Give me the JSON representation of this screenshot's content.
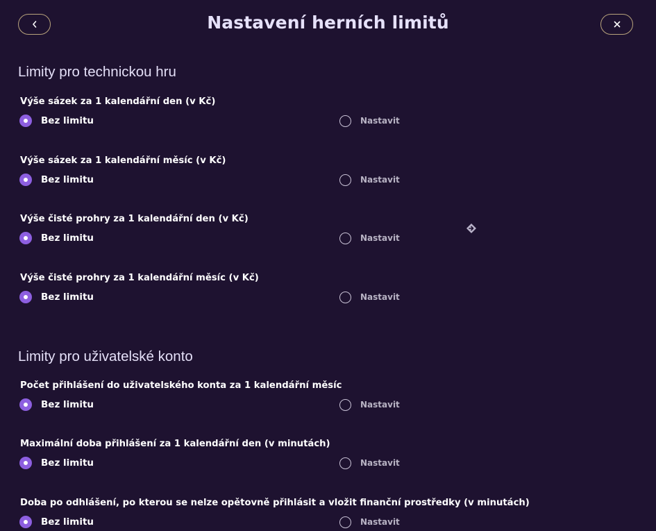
{
  "header": {
    "title": "Nastavení herních limitů",
    "back_icon": "chevron-left-icon",
    "close_icon": "close-icon"
  },
  "sections": [
    {
      "title": "Limity pro technickou hru",
      "items": [
        {
          "label": "Výše sázek za 1 kalendářní den (v Kč)",
          "option_none": "Bez limitu",
          "option_set": "Nastavit",
          "selected": "Bez limitu"
        },
        {
          "label": "Výše sázek za 1 kalendářní měsíc (v Kč)",
          "option_none": "Bez limitu",
          "option_set": "Nastavit",
          "selected": "Bez limitu"
        },
        {
          "label": "Výše čisté prohry za 1 kalendářní den (v Kč)",
          "option_none": "Bez limitu",
          "option_set": "Nastavit",
          "selected": "Bez limitu"
        },
        {
          "label": "Výše čisté prohry za 1 kalendářní měsíc (v Kč)",
          "option_none": "Bez limitu",
          "option_set": "Nastavit",
          "selected": "Bez limitu"
        }
      ]
    },
    {
      "title": "Limity pro uživatelské konto",
      "items": [
        {
          "label": "Počet přihlášení do uživatelského konta za 1 kalendářní měsíc",
          "option_none": "Bez limitu",
          "option_set": "Nastavit",
          "selected": "Bez limitu"
        },
        {
          "label": "Maximální doba přihlášení za 1 kalendářní den (v minutách)",
          "option_none": "Bez limitu",
          "option_set": "Nastavit",
          "selected": "Bez limitu"
        },
        {
          "label": "Doba po odhlášení, po kterou se nelze opětovně přihlásit a vložit finanční prostředky (v minutách)",
          "option_none": "Bez limitu",
          "option_set": "Nastavit",
          "selected": "Bez limitu"
        }
      ]
    }
  ],
  "colors": {
    "background": "#1e1230",
    "accent": "#8d5fe0",
    "button_border": "#b8a37c",
    "title": "#e6e1fa"
  },
  "floating_icon": "diamond-arrow-icon"
}
